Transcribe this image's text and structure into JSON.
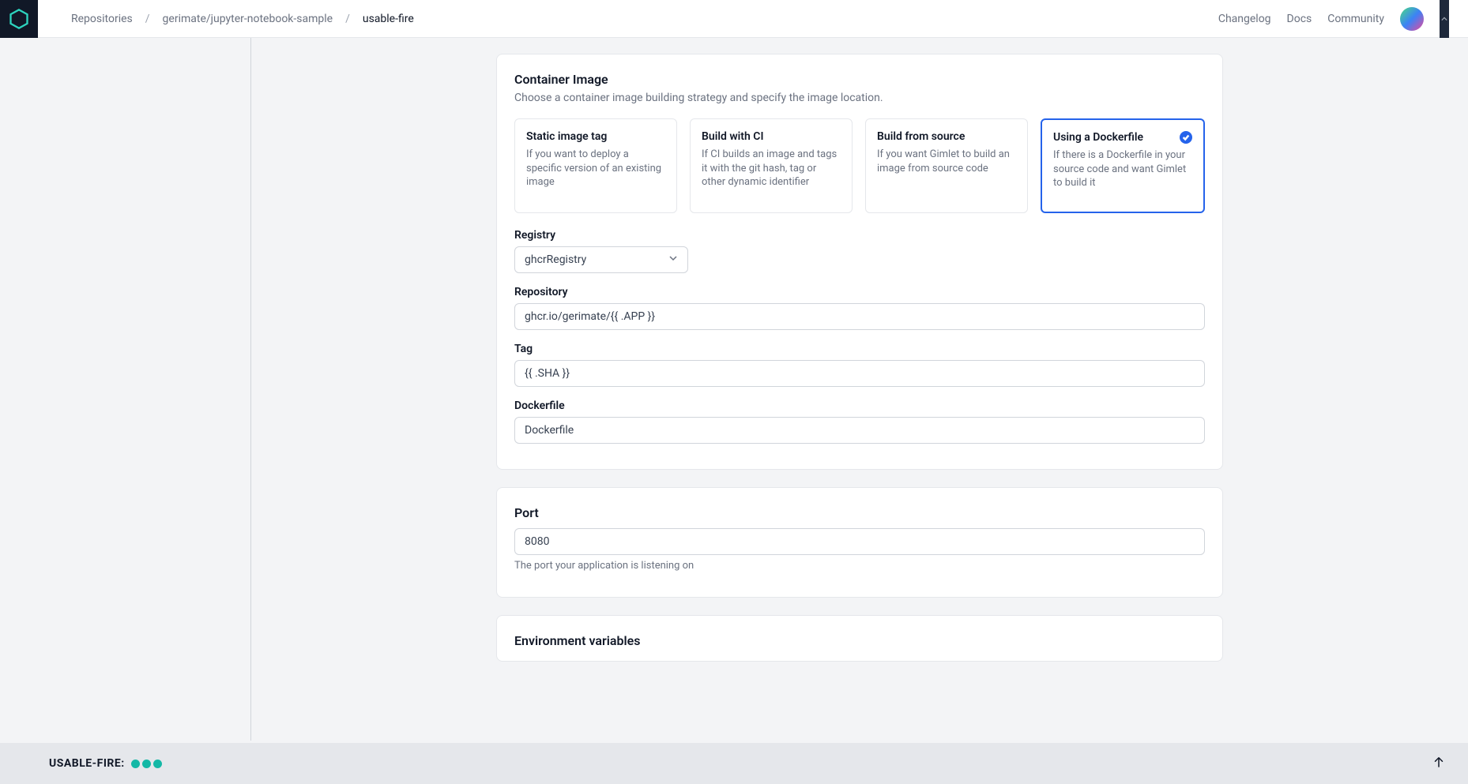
{
  "breadcrumb": {
    "root": "Repositories",
    "repo": "gerimate/jupyter-notebook-sample",
    "current": "usable-fire"
  },
  "navlinks": {
    "changelog": "Changelog",
    "docs": "Docs",
    "community": "Community"
  },
  "container_image": {
    "title": "Container Image",
    "description": "Choose a container image building strategy and specify the image location.",
    "strategies": [
      {
        "title": "Static image tag",
        "sub": "If you want to deploy a specific version of an existing image"
      },
      {
        "title": "Build with CI",
        "sub": "If CI builds an image and tags it with the git hash, tag or other dynamic identifier"
      },
      {
        "title": "Build from source",
        "sub": "If you want Gimlet to build an image from source code"
      },
      {
        "title": "Using a Dockerfile",
        "sub": "If there is a Dockerfile in your source code and want Gimlet to build it"
      }
    ],
    "registry_label": "Registry",
    "registry_value": "ghcrRegistry",
    "repository_label": "Repository",
    "repository_value": "ghcr.io/gerimate/{{ .APP }}",
    "tag_label": "Tag",
    "tag_value": "{{ .SHA }}",
    "dockerfile_label": "Dockerfile",
    "dockerfile_value": "Dockerfile"
  },
  "port_card": {
    "title": "Port",
    "value": "8080",
    "helper": "The port your application is listening on"
  },
  "env_card": {
    "title": "Environment variables"
  },
  "bottombar": {
    "label": "USABLE-FIRE:"
  }
}
